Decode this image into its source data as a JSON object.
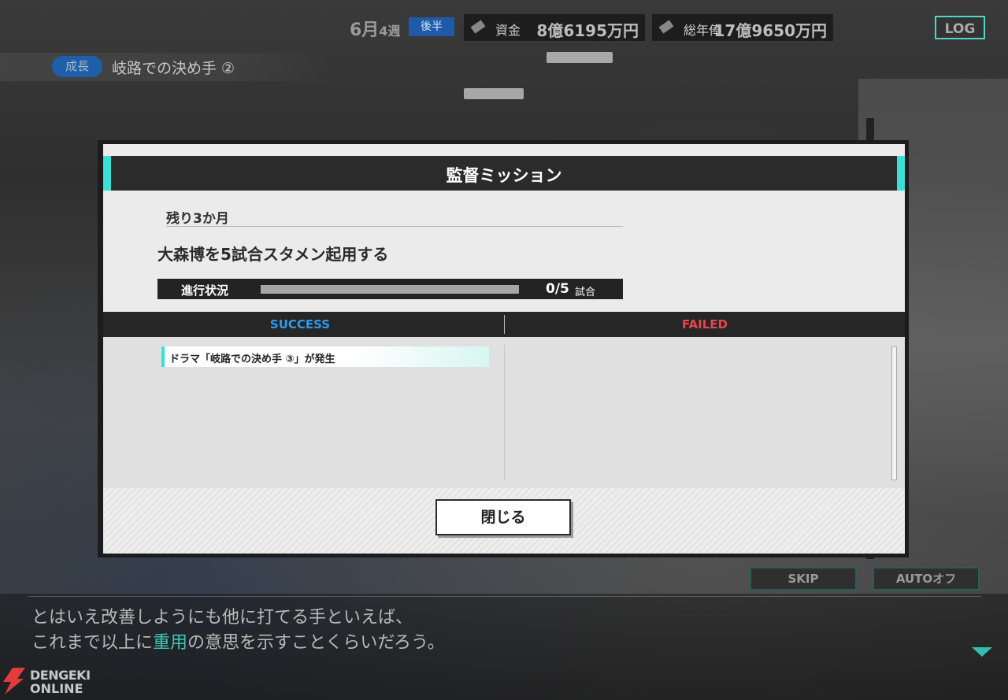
{
  "top": {
    "date_month": "6月",
    "date_week": "4週",
    "half": "後半",
    "funds": {
      "label": "資金",
      "value": "8億6195万円"
    },
    "payroll": {
      "label": "総年俸",
      "value": "17億9650万円"
    },
    "log_label": "LOG"
  },
  "chapter": {
    "tag": "成長",
    "title": "岐路での決め手 ②"
  },
  "modal": {
    "title": "監督ミッション",
    "remaining": "残り3か月",
    "mission": "大森博を5試合スタメン起用する",
    "progress_label": "進行状況",
    "progress_value": "0/5",
    "progress_unit": "試合",
    "progress_fraction": 0,
    "success_header": "SUCCESS",
    "failed_header": "FAILED",
    "success_items": [
      "ドラマ「岐路での決め手 ③」が発生"
    ],
    "close_label": "閉じる"
  },
  "controls": {
    "skip": "SKIP",
    "auto": "AUTOオフ"
  },
  "dialog": {
    "line1": "とはいえ改善しようにも他に打てる手といえば、",
    "line2_before": "これまで以上に",
    "line2_highlight": "重用",
    "line2_after": "の意思を示すことくらいだろう。"
  },
  "watermark": {
    "line1": "DENGEKI",
    "line2": "ONLINE"
  },
  "colors": {
    "accent": "#38e0d6",
    "success": "#2a9bf0",
    "failed": "#e6464f",
    "badge": "#1f5aa8"
  }
}
